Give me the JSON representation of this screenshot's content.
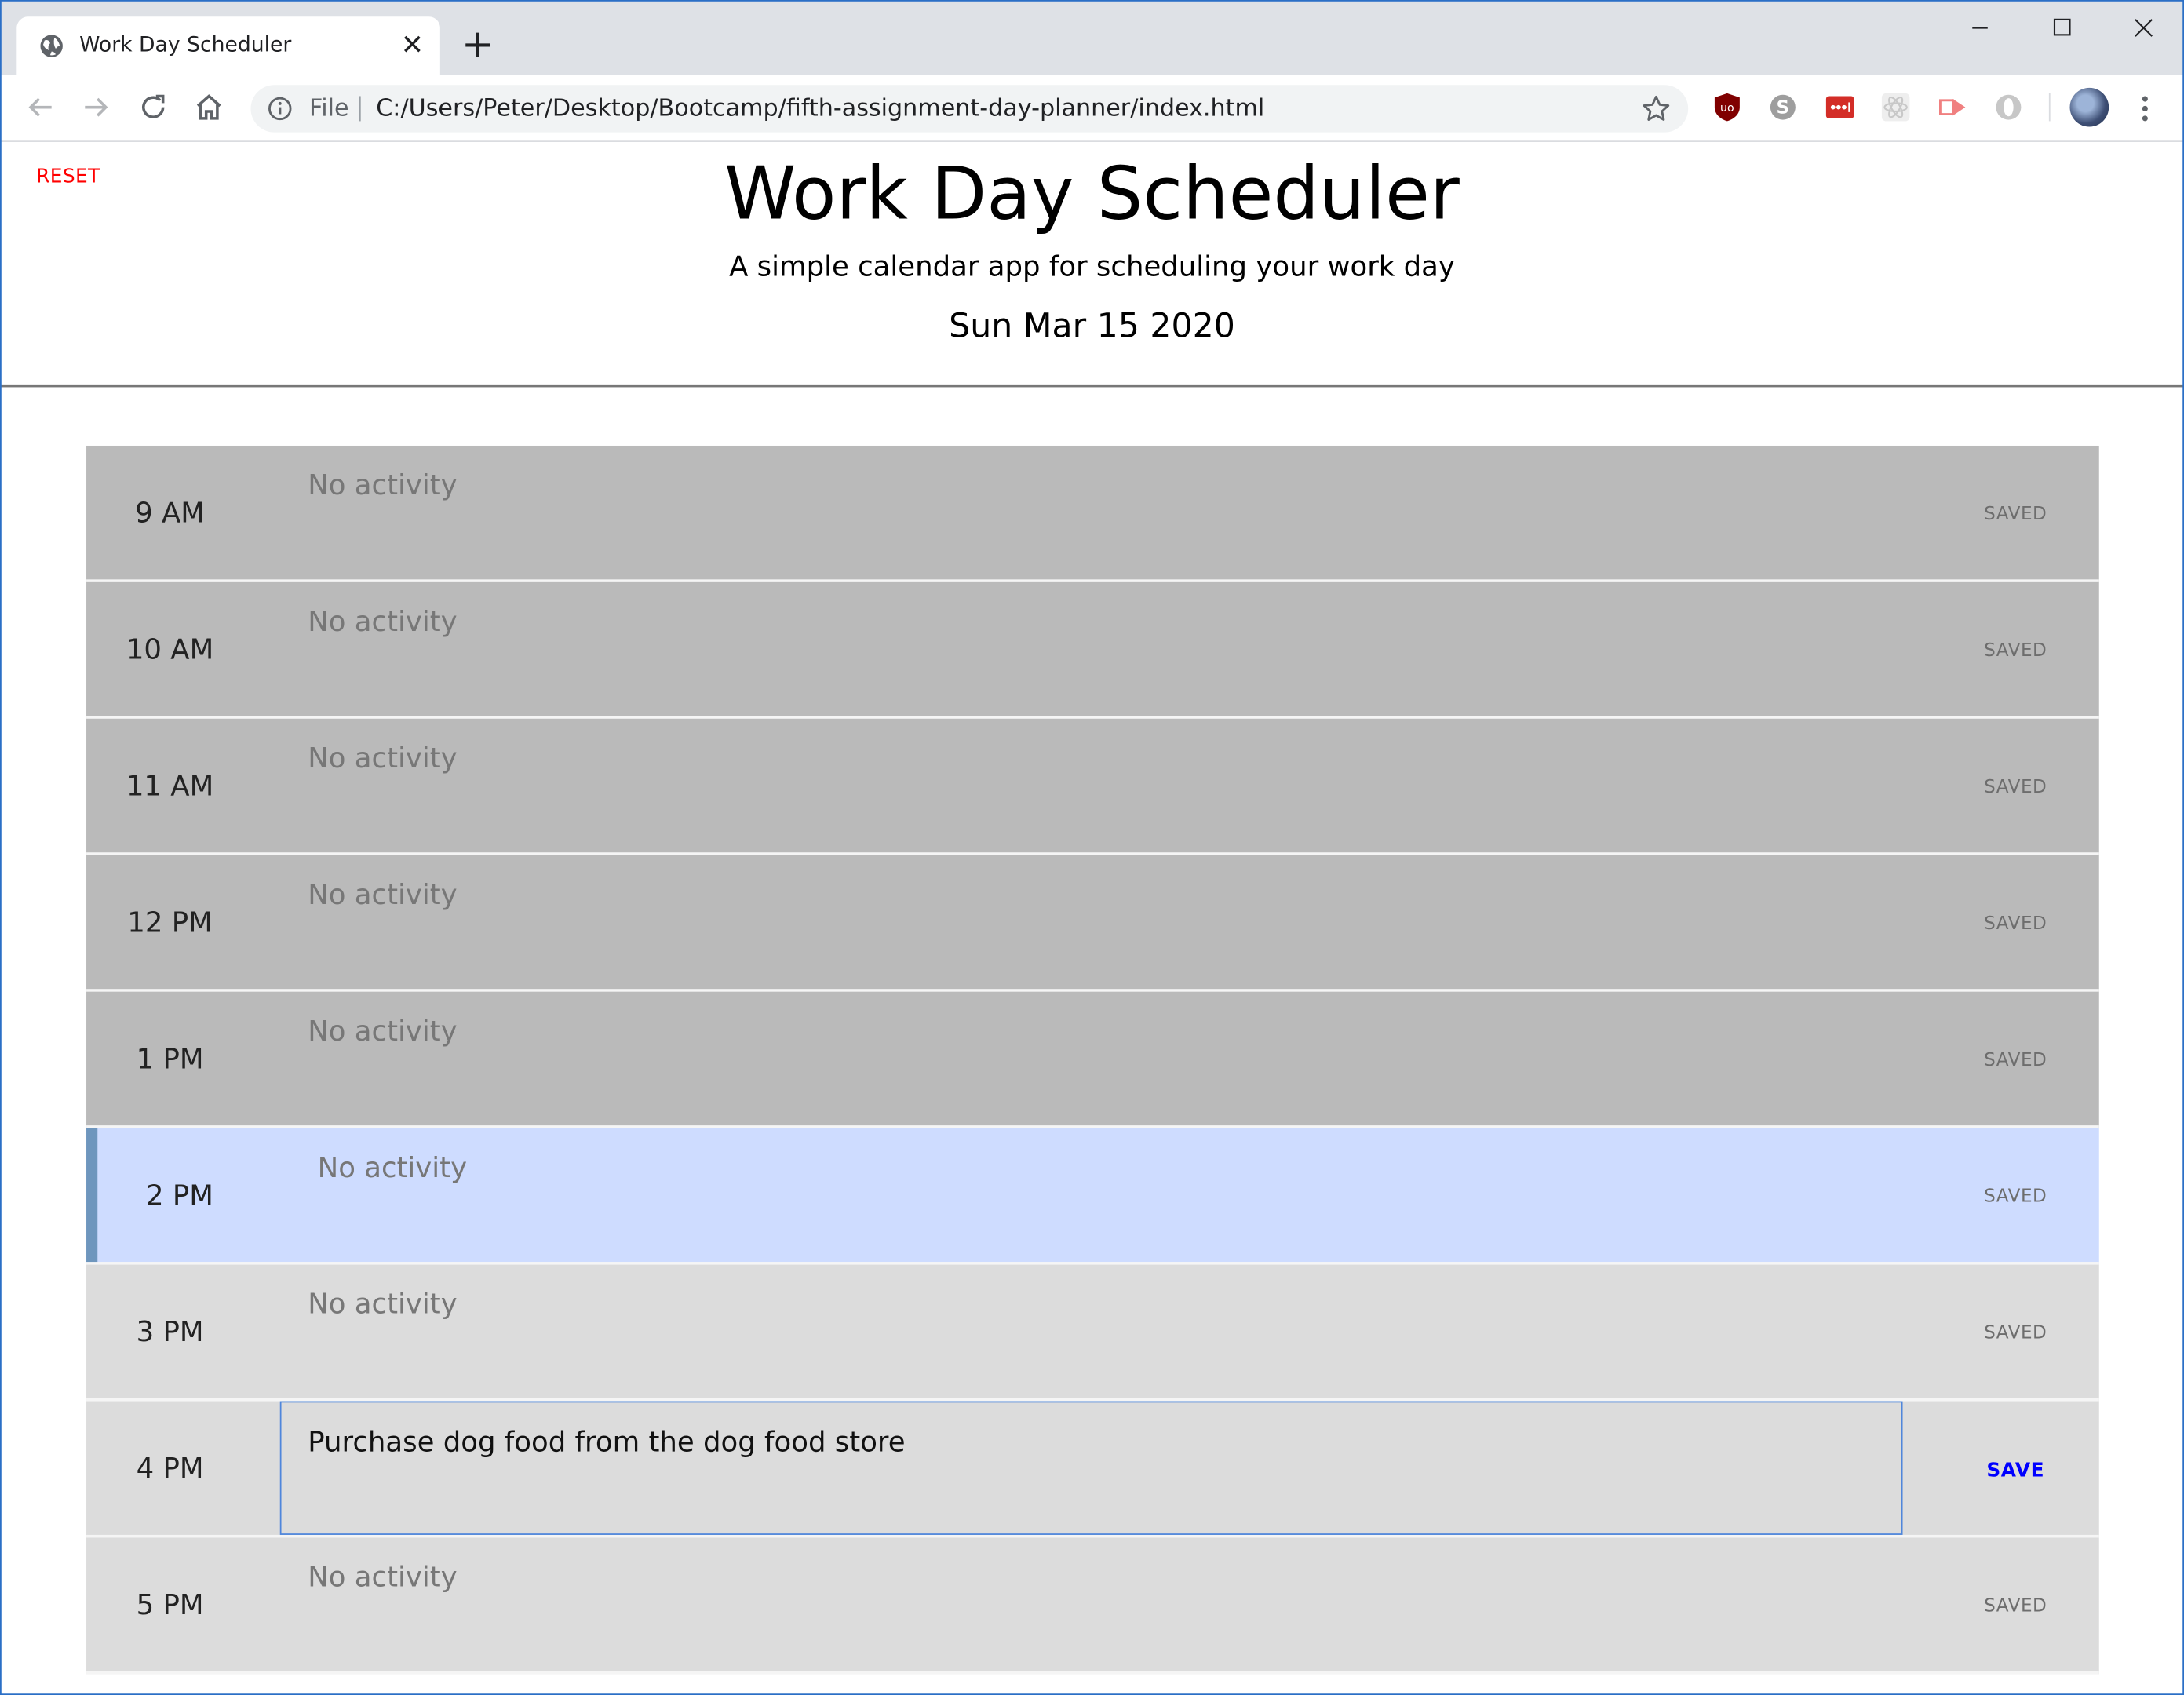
{
  "browser": {
    "tab_title": "Work Day Scheduler",
    "new_tab_symbol": "+",
    "close_symbol": "✕",
    "address": {
      "scheme_label": "File",
      "url": "C:/Users/Peter/Desktop/Bootcamp/fifth-assignment-day-planner/index.html"
    },
    "extensions": [
      "ublock-icon",
      "skype-icon",
      "lastpass-icon",
      "react-devtools-icon",
      "cast-icon",
      "opera-icon"
    ]
  },
  "page": {
    "reset_label": "RESET",
    "title": "Work Day Scheduler",
    "subtitle": "A simple calendar app for scheduling your work day",
    "date": "Sun Mar 15 2020"
  },
  "schedule": {
    "rows": [
      {
        "hour": "9 AM",
        "activity": "No activity",
        "status": "SAVED",
        "state": "past"
      },
      {
        "hour": "10 AM",
        "activity": "No activity",
        "status": "SAVED",
        "state": "past"
      },
      {
        "hour": "11 AM",
        "activity": "No activity",
        "status": "SAVED",
        "state": "past"
      },
      {
        "hour": "12 PM",
        "activity": "No activity",
        "status": "SAVED",
        "state": "past"
      },
      {
        "hour": "1 PM",
        "activity": "No activity",
        "status": "SAVED",
        "state": "past"
      },
      {
        "hour": "2 PM",
        "activity": "No activity",
        "status": "SAVED",
        "state": "present"
      },
      {
        "hour": "3 PM",
        "activity": "No activity",
        "status": "SAVED",
        "state": "future"
      },
      {
        "hour": "4 PM",
        "activity": "Purchase dog food from the dog food store",
        "status": "SAVE",
        "state": "future",
        "editing": true
      },
      {
        "hour": "5 PM",
        "activity": "No activity",
        "status": "SAVED",
        "state": "future"
      }
    ]
  },
  "colors": {
    "past": "#bababa",
    "present": "#cedcff",
    "present_accent": "#6e96bd",
    "future": "#dcdcdc",
    "reset": "#ff0000",
    "save_active": "#0000ff"
  }
}
